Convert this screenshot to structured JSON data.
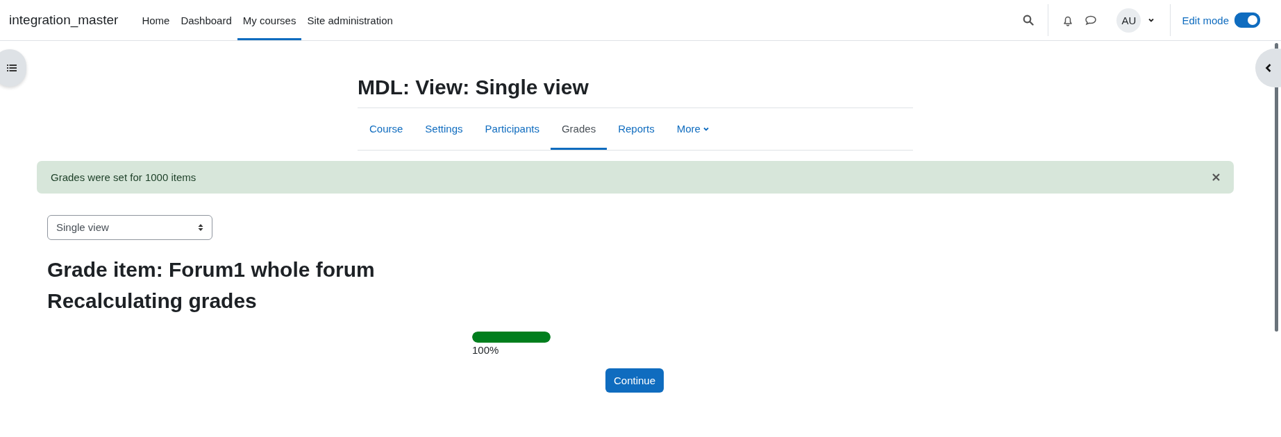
{
  "navbar": {
    "site_name": "integration_master",
    "items": [
      {
        "label": "Home",
        "selected": false
      },
      {
        "label": "Dashboard",
        "selected": false
      },
      {
        "label": "My courses",
        "selected": true
      },
      {
        "label": "Site administration",
        "selected": false
      }
    ],
    "avatar": "AU",
    "edit_mode": {
      "label": "Edit mode",
      "on": true
    }
  },
  "page_title": "MDL: View: Single view",
  "course_tabs": [
    {
      "label": "Course",
      "selected": false
    },
    {
      "label": "Settings",
      "selected": false
    },
    {
      "label": "Participants",
      "selected": false
    },
    {
      "label": "Grades",
      "selected": true
    },
    {
      "label": "Reports",
      "selected": false
    },
    {
      "label": "More",
      "selected": false,
      "kind": "dropdown"
    }
  ],
  "alert": {
    "message": "Grades were set for 1000 items"
  },
  "report_select": {
    "value": "Single view"
  },
  "headings": [
    "Grade item: Forum1 whole forum",
    "Recalculating grades"
  ],
  "progress": {
    "level": 1,
    "reading": "100%"
  },
  "continue_button": "Continue"
}
